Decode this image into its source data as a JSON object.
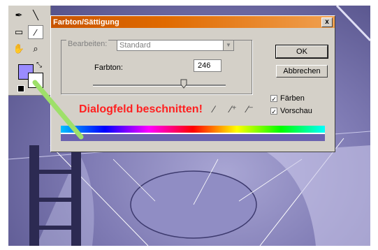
{
  "dialog": {
    "title": "Farbton/Sättigung",
    "close_glyph": "x",
    "edit_label": "Bearbeiten:",
    "edit_value": "Standard",
    "hue_label": "Farbton:",
    "hue_value": "246",
    "hue_range": [
      -180,
      180
    ],
    "ok_label": "OK",
    "cancel_label": "Abbrechen",
    "colorize_label": "Färben",
    "colorize_checked": true,
    "preview_label": "Vorschau",
    "preview_checked": true,
    "cropped_text": "Dialogfeld beschnitten!",
    "icons": [
      "eyedropper-icon",
      "eyedropper-plus-icon",
      "eyedropper-minus-icon"
    ]
  },
  "toolbox": {
    "tools": [
      "pen-icon",
      "line-icon",
      "stamp-icon",
      "eyedropper-icon",
      "hand-icon",
      "zoom-icon"
    ],
    "foreground_color": "#9a8cff",
    "background_color": "#ffffff"
  },
  "colors": {
    "title_start": "#c85400",
    "cropped_text": "#ff2020",
    "annotation_arrow": "#9ee06a",
    "tinted_bar": "#6a62b0"
  }
}
